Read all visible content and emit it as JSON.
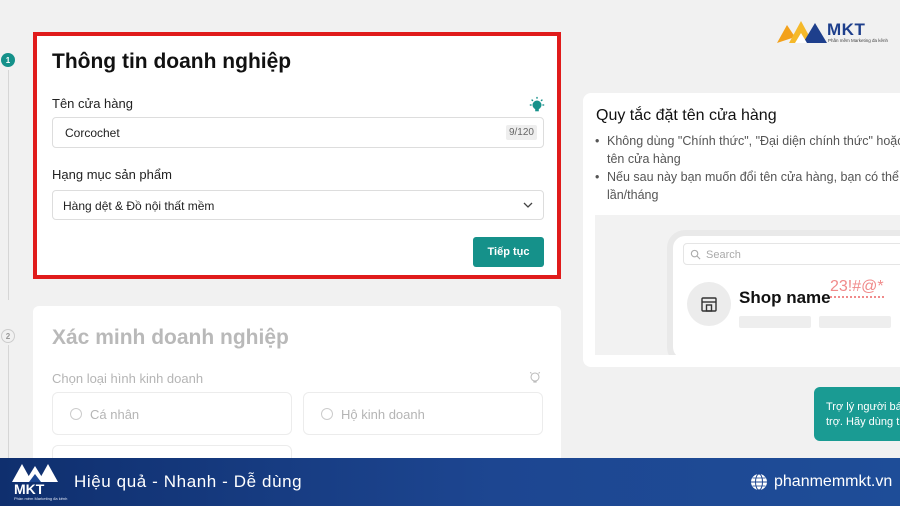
{
  "steps": [
    "1",
    "2"
  ],
  "business_info": {
    "title": "Thông tin doanh nghiệp",
    "store_name_label": "Tên cửa hàng",
    "store_name_value": "Corcochet",
    "store_name_counter": "9/120",
    "category_label": "Hạng mục sản phẩm",
    "category_value": "Hàng dệt & Đồ nội thất mềm",
    "next_button": "Tiếp tục"
  },
  "verification": {
    "title": "Xác minh doanh nghiệp",
    "business_type_label": "Chọn loại hình kinh doanh",
    "options": [
      "Cá nhân",
      "Hộ kinh doanh"
    ]
  },
  "rules": {
    "title": "Quy tắc đặt tên cửa hàng",
    "items": [
      "Không dùng \"Chính thức\", \"Đại diện chính thức\" hoặc",
      "tên cửa hàng",
      "Nếu sau này bạn muốn đổi tên cửa hàng, bạn có thể t",
      "lần/tháng"
    ],
    "mock": {
      "search_placeholder": "Search",
      "shop_name": "Shop name",
      "invalid_chars": "23!#@*"
    }
  },
  "assistant": {
    "line1": "Trợ lý người bán",
    "line2": "trợ. Hãy dùng t"
  },
  "brand": {
    "logo_text": "MKT",
    "logo_subtext": "Phần mềm Marketing đa kênh",
    "slogan": "Hiệu quả - Nhanh  - Dễ dùng",
    "website": "phanmemmkt.vn"
  },
  "colors": {
    "teal": "#15918a",
    "highlight_border": "#e01b1b",
    "footer_blue": "#1d4691"
  }
}
